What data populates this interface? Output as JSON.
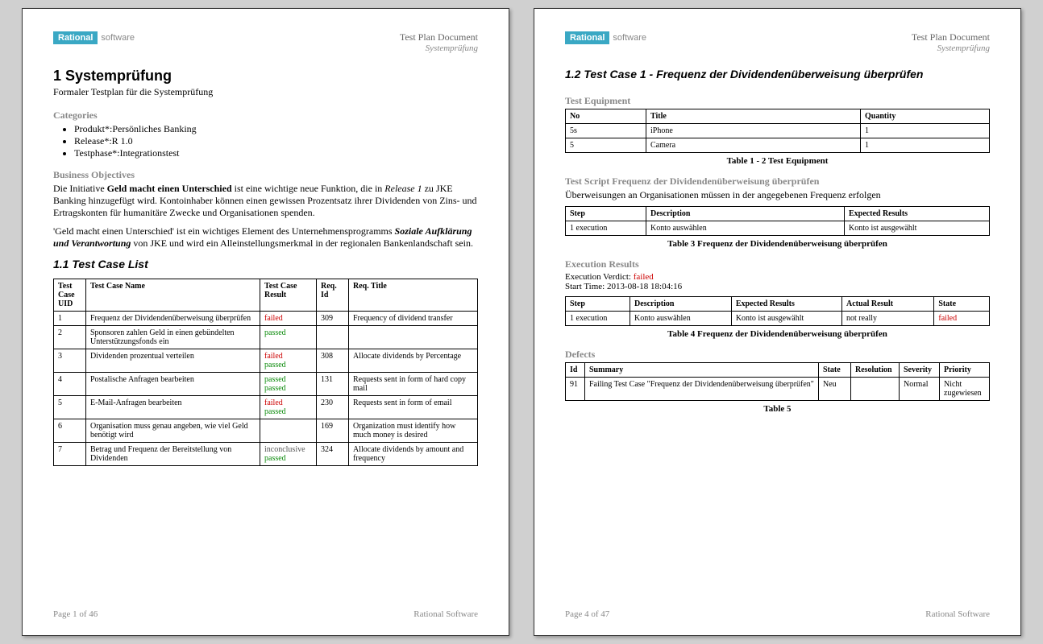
{
  "logo": {
    "left": "Rational",
    "right": "software"
  },
  "header": {
    "title": "Test Plan Document",
    "subtitle": "Systemprüfung"
  },
  "page1": {
    "h1": "1   Systemprüfung",
    "subtitle": "Formaler Testplan für die Systemprüfung",
    "categories_label": "Categories",
    "categories": [
      "Produkt*:Persönliches Banking",
      "Release*:R 1.0",
      "Testphase*:Integrationstest"
    ],
    "bo_label": "Business Objectives",
    "bo_p1a": "Die Initiative ",
    "bo_p1b": "Geld macht einen Unterschied",
    "bo_p1c": " ist eine wichtige neue Funktion, die in ",
    "bo_p1d": "Release 1",
    "bo_p1e": " zu JKE Banking hinzugefügt wird. Kontoinhaber können einen gewissen Prozentsatz ihrer Dividenden von Zins- und Ertragskonten für humanitäre Zwecke und Organisationen spenden.",
    "bo_p2a": "'Geld macht einen Unterschied' ist ein wichtiges Element des Unternehmensprogramms ",
    "bo_p2b": "Soziale Aufklärung und Verantwortung",
    "bo_p2c": " von JKE und wird ein Alleinstellungsmerkmal in der regionalen Bankenlandschaft sein.",
    "h2": "1.1  Test Case List",
    "table_headers": [
      "Test Case UID",
      "Test Case Name",
      "Test Case Result",
      "Req. Id",
      "Req. Title"
    ],
    "rows": [
      {
        "uid": "1",
        "name": "Frequenz der Dividendenüberweisung überprüfen",
        "results": [
          {
            "txt": "failed",
            "cls": "failed"
          }
        ],
        "reqid": "309",
        "reqtitle": "Frequency of dividend transfer"
      },
      {
        "uid": "2",
        "name": "Sponsoren zahlen Geld in einen gebündelten Unterstützungsfonds ein",
        "results": [
          {
            "txt": "passed",
            "cls": "passed"
          }
        ],
        "reqid": "",
        "reqtitle": ""
      },
      {
        "uid": "3",
        "name": "Dividenden prozentual verteilen",
        "results": [
          {
            "txt": "failed",
            "cls": "failed"
          },
          {
            "txt": "passed",
            "cls": "passed"
          }
        ],
        "reqid": "308",
        "reqtitle": "Allocate dividends by Percentage"
      },
      {
        "uid": "4",
        "name": "Postalische Anfragen bearbeiten",
        "results": [
          {
            "txt": "passed",
            "cls": "passed"
          },
          {
            "txt": "passed",
            "cls": "passed"
          }
        ],
        "reqid": "131",
        "reqtitle": "Requests sent in form of hard copy mail"
      },
      {
        "uid": "5",
        "name": "E-Mail-Anfragen bearbeiten",
        "results": [
          {
            "txt": "failed",
            "cls": "failed"
          },
          {
            "txt": "passed",
            "cls": "passed"
          }
        ],
        "reqid": "230",
        "reqtitle": "Requests sent in form of email"
      },
      {
        "uid": "6",
        "name": "Organisation muss genau angeben, wie viel Geld benötigt wird",
        "results": [],
        "reqid": "169",
        "reqtitle": "Organization must identify how much money is desired"
      },
      {
        "uid": "7",
        "name": "Betrag und Frequenz der Bereitstellung von Dividenden",
        "results": [
          {
            "txt": "inconclusive",
            "cls": "inconclusive"
          },
          {
            "txt": "passed",
            "cls": "passed"
          }
        ],
        "reqid": "324",
        "reqtitle": "Allocate dividends by amount and frequency"
      }
    ],
    "footer_left": "Page 1 of  46",
    "footer_right": "Rational Software"
  },
  "page2": {
    "h2": "1.2  Test Case 1 - Frequenz der Dividendenüberweisung überprüfen",
    "equip_label": "Test Equipment",
    "equip_headers": [
      "No",
      "Title",
      "Quantity"
    ],
    "equip_rows": [
      {
        "no": "5s",
        "title": "iPhone",
        "qty": "1"
      },
      {
        "no": "5",
        "title": "Camera",
        "qty": "1"
      }
    ],
    "equip_caption": "Table 1 - 2 Test Equipment",
    "script_label": "Test Script Frequenz der Dividendenüberweisung überprüfen",
    "script_desc": "Überweisungen an Organisationen müssen in der angegebenen Frequenz erfolgen",
    "script_headers": [
      "Step",
      "Description",
      "Expected Results"
    ],
    "script_rows": [
      {
        "step": "1 execution",
        "desc": "Konto auswählen",
        "exp": "Konto ist ausgewählt"
      }
    ],
    "script_caption": "Table 3 Frequenz der Dividendenüberweisung überprüfen",
    "exec_label": "Execution Results",
    "exec_verdict_label": "Execution Verdict: ",
    "exec_verdict_value": "failed",
    "exec_start": "Start Time: 2013-08-18 18:04:16",
    "exec_headers": [
      "Step",
      "Description",
      "Expected Results",
      "Actual Result",
      "State"
    ],
    "exec_rows": [
      {
        "step": "1 execution",
        "desc": "Konto auswählen",
        "exp": "Konto ist ausgewählt",
        "act": "not really",
        "state": "failed",
        "state_cls": "failed"
      }
    ],
    "exec_caption": "Table 4 Frequenz der Dividendenüberweisung überprüfen",
    "defects_label": "Defects",
    "defects_headers": [
      "Id",
      "Summary",
      "State",
      "Resolution",
      "Severity",
      "Priority"
    ],
    "defects_rows": [
      {
        "id": "91",
        "summary": "Failing Test Case \"Frequenz der Dividendenüberweisung überprüfen\"",
        "state": "Neu",
        "resolution": "",
        "severity": "Normal",
        "priority": "Nicht zugewiesen"
      }
    ],
    "defects_caption": "Table 5",
    "footer_left": "Page 4 of  47",
    "footer_right": "Rational Software"
  }
}
